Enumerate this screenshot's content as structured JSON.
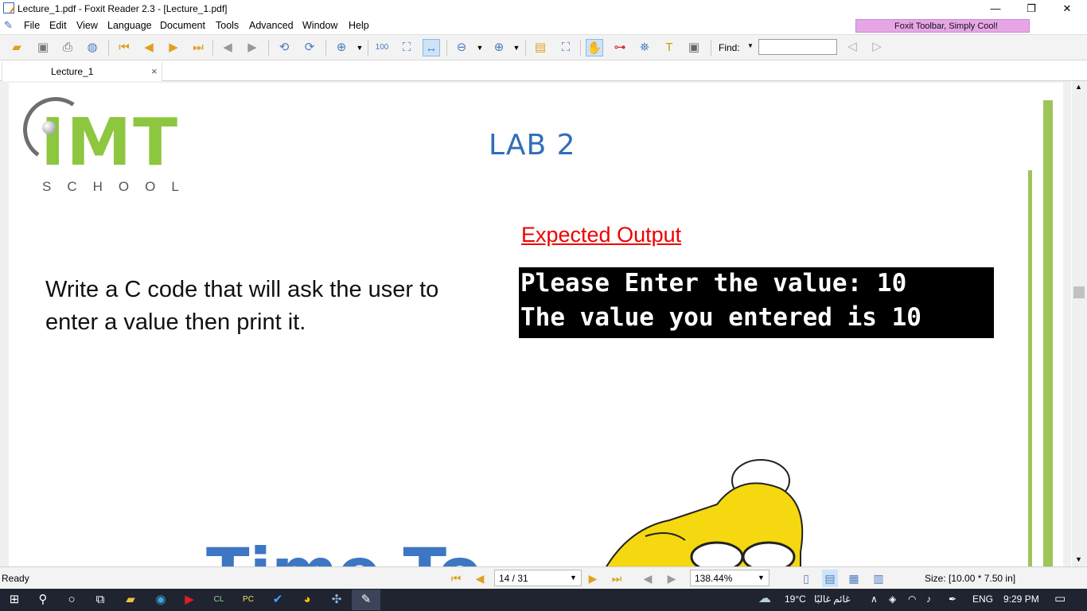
{
  "window": {
    "title": "Lecture_1.pdf - Foxit Reader 2.3 - [Lecture_1.pdf]",
    "controls": {
      "minimize": "—",
      "restore": "❐",
      "close": "✕"
    }
  },
  "menu": [
    "File",
    "Edit",
    "View",
    "Language",
    "Document",
    "Tools",
    "Advanced",
    "Window",
    "Help"
  ],
  "promo": "Foxit Toolbar, Simply Cool!",
  "toolbar": {
    "find_label": "Find:",
    "find_value": ""
  },
  "tab": {
    "label": "Lecture_1",
    "close": "×"
  },
  "document": {
    "logo_main": "IMT",
    "logo_sub": "SCHOOL",
    "lab_title": "LAB 2",
    "expected_heading": "Expected Output",
    "terminal_lines": [
      "Please Enter the value: 10",
      "The value you entered is 10"
    ],
    "task": "Write a C code that will ask the user to enter a value then print it.",
    "banner": "Time To"
  },
  "status": {
    "state": "Ready",
    "page": "14 / 31",
    "zoom": "138.44%",
    "size": "Size: [10.00 * 7.50 in]"
  },
  "taskbar": {
    "weather": "19°C",
    "weather_desc": "غائم غالبًا",
    "lang": "ENG",
    "time": "9:29 PM"
  },
  "colors": {
    "logo_green": "#8dc63f",
    "lab_blue": "#2f6fb7",
    "expected_red": "#ee0000",
    "taskbar": "#1f2430"
  }
}
